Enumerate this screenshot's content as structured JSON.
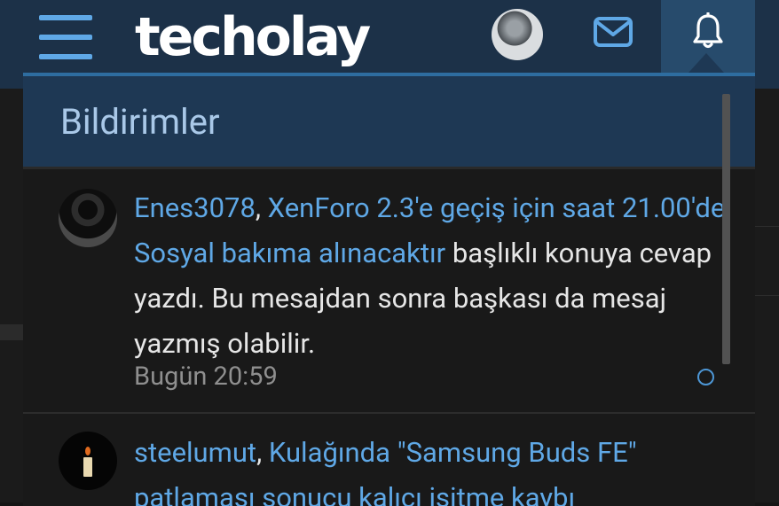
{
  "header": {
    "logo_text": "techolay",
    "menu_icon": "hamburger-menu-icon",
    "avatar_icon": "user-avatar",
    "mail_icon": "envelope-icon",
    "bell_icon": "bell-icon"
  },
  "panel": {
    "title": "Bildirimler"
  },
  "notifications": [
    {
      "user": "Enes3078",
      "separator": ", ",
      "thread": "XenForo 2.3'e geçiş için saat 21.00'de Sosyal bakıma alınacaktır",
      "message": " başlıklı konuya cevap yazdı. Bu mesajdan sonra başkası da mesaj yazmış olabilir.",
      "time": "Bugün 20:59",
      "status_icon": "unread-circle-icon"
    },
    {
      "user": "steelumut",
      "separator": ", ",
      "thread": "Kulağında \"Samsung Buds FE\" patlaması sonucu kalıcı işitme kaybı",
      "avatar_icon": "candle-icon"
    }
  ],
  "colors": {
    "brand_blue": "#5fa8e6",
    "header_bg": "#1c3148",
    "panel_header_bg": "#1e3854",
    "active_tab_bg": "#274b6c",
    "panel_bg": "#191919"
  }
}
